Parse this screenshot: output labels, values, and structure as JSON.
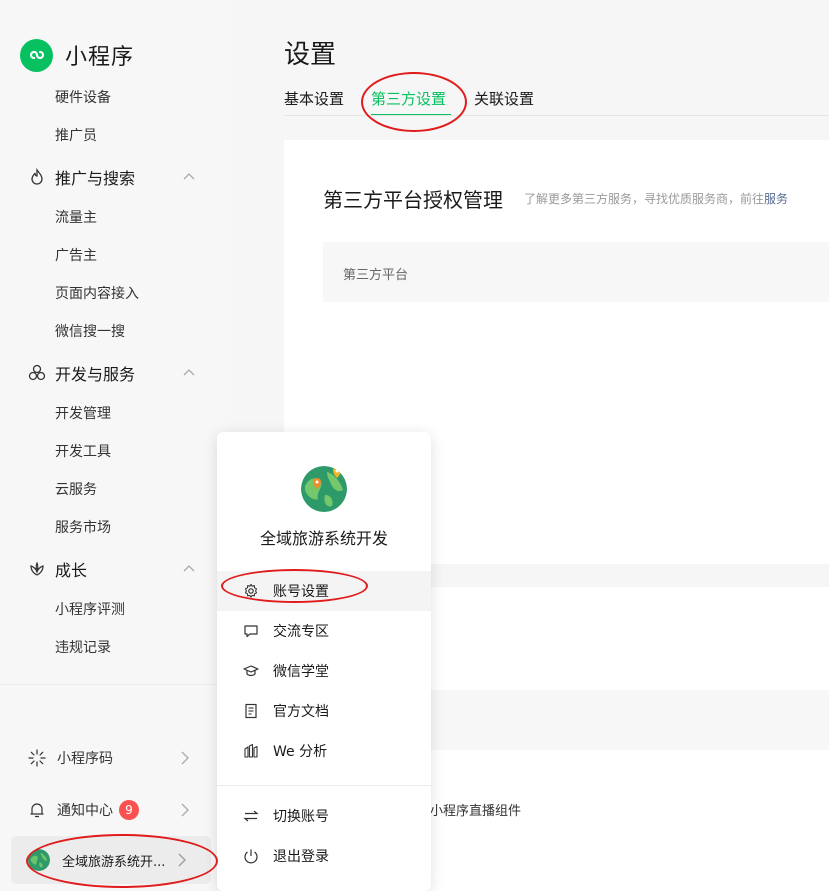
{
  "brand": {
    "name": "小程序"
  },
  "sidebar": {
    "items_top": [
      {
        "label": "硬件设备"
      },
      {
        "label": "推广员"
      }
    ],
    "groups": [
      {
        "label": "推广与搜索",
        "icon": "flame-icon",
        "items": [
          "流量主",
          "广告主",
          "页面内容接入",
          "微信搜一搜"
        ]
      },
      {
        "label": "开发与服务",
        "icon": "cluster-icon",
        "items": [
          "开发管理",
          "开发工具",
          "云服务",
          "服务市场"
        ]
      },
      {
        "label": "成长",
        "icon": "lotus-icon",
        "items": [
          "小程序评测",
          "违规记录"
        ]
      }
    ],
    "bottom": {
      "qrcode_label": "小程序码",
      "notice_label": "通知中心",
      "notice_count": "9",
      "account_label": "全域旅游系统开..."
    }
  },
  "main": {
    "title": "设置",
    "tabs": [
      {
        "label": "基本设置"
      },
      {
        "label": "第三方设置"
      },
      {
        "label": "关联设置"
      }
    ],
    "card": {
      "title": "第三方平台授权管理",
      "desc": "了解更多第三方服务，寻找优质服务商，前往",
      "desc_link": "服务",
      "table_header": "第三方平台"
    },
    "plugin_text": "小程序直播组件"
  },
  "popup": {
    "account_name": "全域旅游系统开发",
    "menu": [
      {
        "label": "账号设置",
        "icon": "gear-icon"
      },
      {
        "label": "交流专区",
        "icon": "chat-bubble-icon"
      },
      {
        "label": "微信学堂",
        "icon": "graduation-cap-icon"
      },
      {
        "label": "官方文档",
        "icon": "document-icon"
      },
      {
        "label": "We 分析",
        "icon": "analytics-icon"
      }
    ],
    "menu_bottom": [
      {
        "label": "切换账号",
        "icon": "switch-arrows-icon"
      },
      {
        "label": "退出登录",
        "icon": "power-icon"
      }
    ]
  },
  "colors": {
    "accent": "#07c160",
    "badge": "#fa5151",
    "annotation": "#e01c1c",
    "link": "#576b95"
  }
}
